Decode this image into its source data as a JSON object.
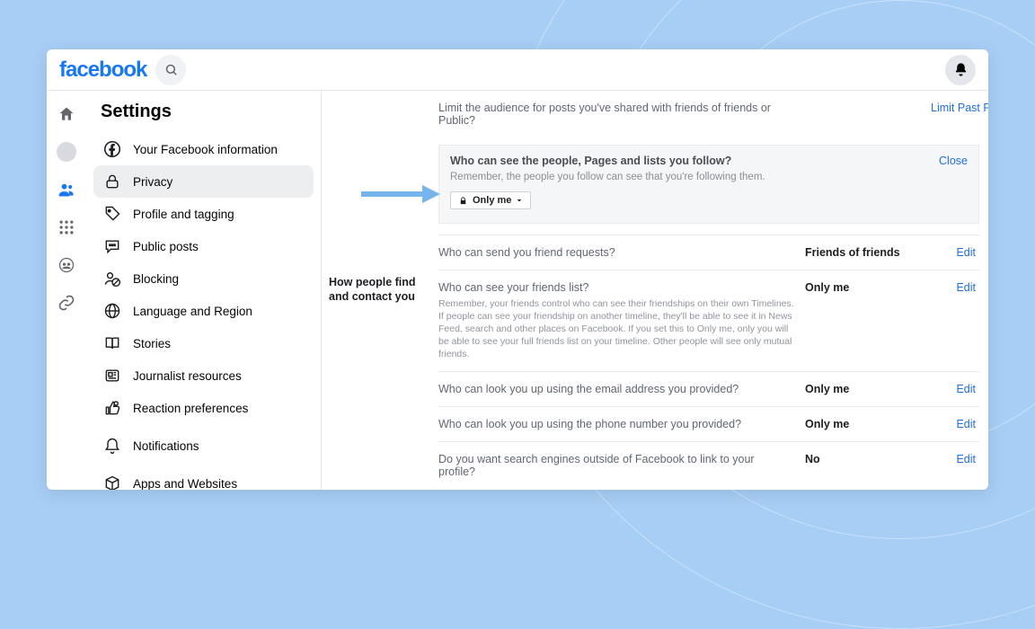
{
  "brand": "facebook",
  "sidebar": {
    "title": "Settings",
    "items": [
      {
        "label": "Your Facebook information"
      },
      {
        "label": "Privacy"
      },
      {
        "label": "Profile and tagging"
      },
      {
        "label": "Public posts"
      },
      {
        "label": "Blocking"
      },
      {
        "label": "Language and Region"
      },
      {
        "label": "Stories"
      },
      {
        "label": "Journalist resources"
      },
      {
        "label": "Reaction preferences"
      },
      {
        "label": "Notifications"
      },
      {
        "label": "Apps and Websites"
      }
    ]
  },
  "content": {
    "limit": {
      "question": "Limit the audience for posts you've shared with friends of friends or Public?",
      "action": "Limit Past Posts"
    },
    "expanded": {
      "title": "Who can see the people, Pages and lists you follow?",
      "desc": "Remember, the people you follow can see that you're following them.",
      "selector": "Only me",
      "close": "Close"
    },
    "section_label": "How people find and contact you",
    "rows": [
      {
        "question": "Who can send you friend requests?",
        "value": "Friends of friends",
        "action": "Edit"
      },
      {
        "question": "Who can see your friends list?",
        "sub": "Remember, your friends control who can see their friendships on their own Timelines. If people can see your friendship on another timeline, they'll be able to see it in News Feed, search and other places on Facebook. If you set this to Only me, only you will be able to see your full friends list on your timeline. Other people will see only mutual friends.",
        "value": "Only me",
        "action": "Edit"
      },
      {
        "question": "Who can look you up using the email address you provided?",
        "value": "Only me",
        "action": "Edit"
      },
      {
        "question": "Who can look you up using the phone number you provided?",
        "value": "Only me",
        "action": "Edit"
      },
      {
        "question": "Do you want search engines outside of Facebook to link to your profile?",
        "value": "No",
        "action": "Edit"
      }
    ]
  }
}
